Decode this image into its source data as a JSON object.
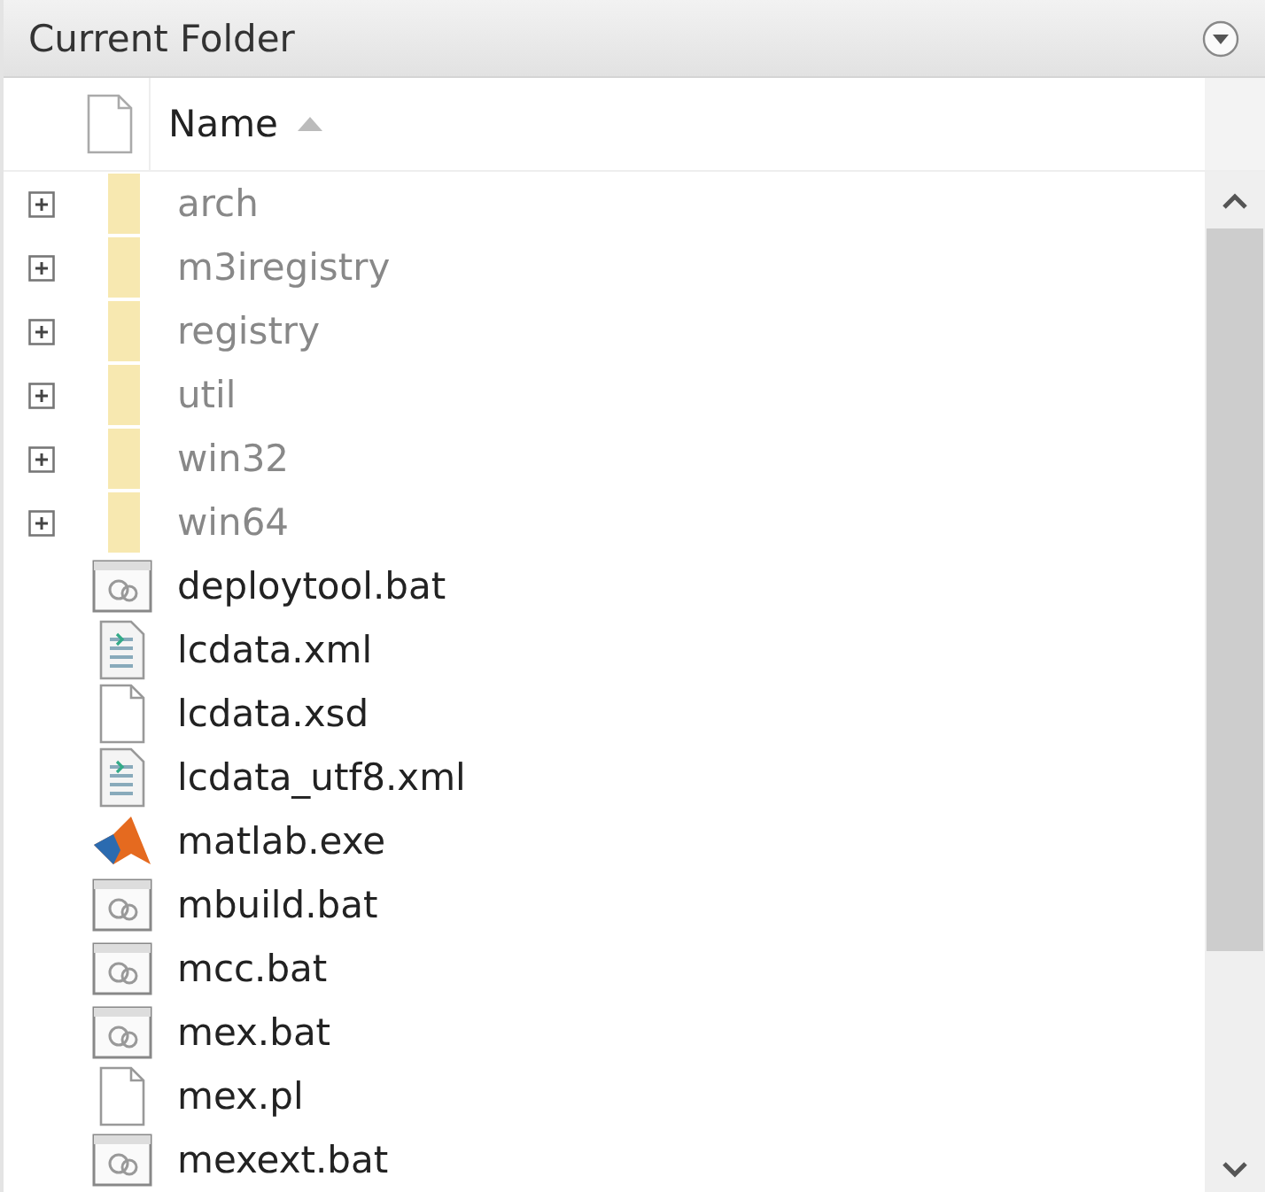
{
  "panel": {
    "title": "Current Folder"
  },
  "column": {
    "label": "Name",
    "sorted_ascending": true
  },
  "items": [
    {
      "name": "arch",
      "kind": "folder",
      "expanded": false
    },
    {
      "name": "m3iregistry",
      "kind": "folder",
      "expanded": false
    },
    {
      "name": "registry",
      "kind": "folder",
      "expanded": false
    },
    {
      "name": "util",
      "kind": "folder",
      "expanded": false
    },
    {
      "name": "win32",
      "kind": "folder",
      "expanded": false
    },
    {
      "name": "win64",
      "kind": "folder",
      "expanded": false
    },
    {
      "name": "deploytool.bat",
      "kind": "batch"
    },
    {
      "name": "lcdata.xml",
      "kind": "xml"
    },
    {
      "name": "lcdata.xsd",
      "kind": "blank"
    },
    {
      "name": "lcdata_utf8.xml",
      "kind": "xml"
    },
    {
      "name": "matlab.exe",
      "kind": "exe"
    },
    {
      "name": "mbuild.bat",
      "kind": "batch"
    },
    {
      "name": "mcc.bat",
      "kind": "batch"
    },
    {
      "name": "mex.bat",
      "kind": "batch"
    },
    {
      "name": "mex.pl",
      "kind": "blank"
    },
    {
      "name": "mexext.bat",
      "kind": "batch"
    }
  ]
}
